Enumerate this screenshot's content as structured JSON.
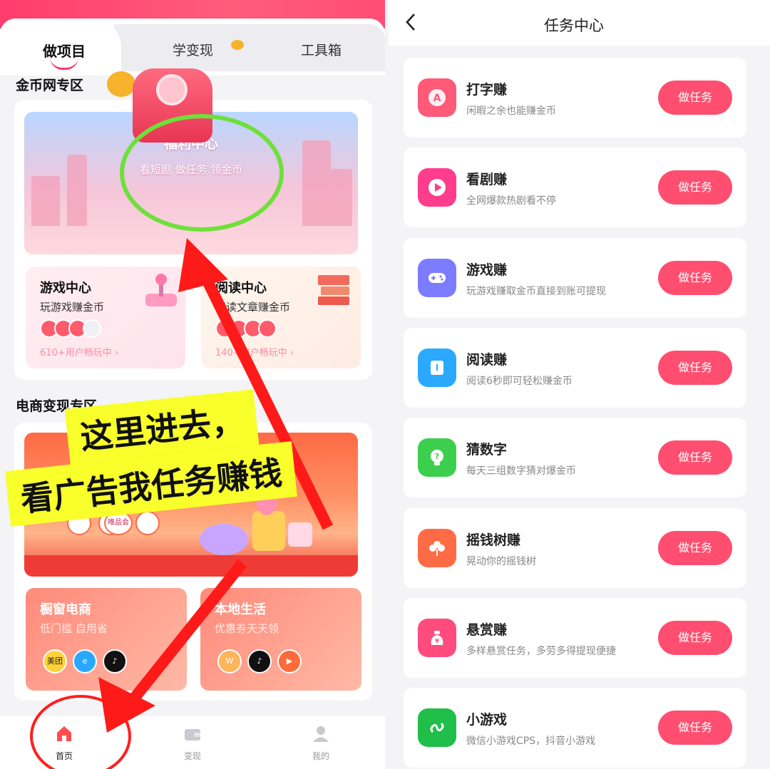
{
  "left": {
    "tabs": [
      "做项目",
      "学变现",
      "工具箱"
    ],
    "section_gold": "金币网专区",
    "welfare": {
      "title": "福利中心",
      "subtitle": "看短剧 做任务 领金币"
    },
    "game_center": {
      "title": "游戏中心",
      "subtitle": "玩游戏赚金币",
      "count": "610+用户畅玩中 ›"
    },
    "read_center": {
      "title": "阅读中心",
      "subtitle": "阅读文章赚金币",
      "count": "140+用户畅玩中 ›"
    },
    "section_ecom": "电商变现专区",
    "ecom_tag": "唯品会",
    "shopwindow": {
      "title": "橱窗电商",
      "subtitle": "低门槛 自用省",
      "icon_meituan": "美团"
    },
    "local_life": {
      "title": "本地生活",
      "subtitle": "优惠券天天领"
    },
    "nav": {
      "home": "首页",
      "monetize": "变现",
      "mine": "我的"
    },
    "annotation": {
      "line1": "这里进去，",
      "line2": "看广告我任务赚钱"
    }
  },
  "right": {
    "title": "任务中心",
    "button_label": "做任务",
    "tasks": [
      {
        "title": "打字赚",
        "subtitle": "闲暇之余也能赚金币",
        "color": "#ff5a78",
        "icon": "typing-icon"
      },
      {
        "title": "看剧赚",
        "subtitle": "全网爆款热剧看不停",
        "color": "#ff3d8c",
        "icon": "play-icon"
      },
      {
        "title": "游戏赚",
        "subtitle": "玩游戏赚取金币直接到账可提现",
        "color": "#7b7cff",
        "icon": "gamepad-icon"
      },
      {
        "title": "阅读赚",
        "subtitle": "阅读6秒即可轻松赚金币",
        "color": "#2aa9ff",
        "icon": "book-icon"
      },
      {
        "title": "猜数字",
        "subtitle": "每天三组数字猜对爆金币",
        "color": "#3ccf4e",
        "icon": "bulb-icon"
      },
      {
        "title": "摇钱树赚",
        "subtitle": "晃动你的摇钱树",
        "color": "#ff6b44",
        "icon": "money-tree-icon"
      },
      {
        "title": "悬赏赚",
        "subtitle": "多样悬赏任务，多劳多得提现便捷",
        "color": "#ff4b7d",
        "icon": "money-bag-icon"
      },
      {
        "title": "小游戏",
        "subtitle": "微信小游戏CPS，抖音小游戏",
        "color": "#1fbf4a",
        "icon": "mini-program-icon"
      }
    ]
  }
}
